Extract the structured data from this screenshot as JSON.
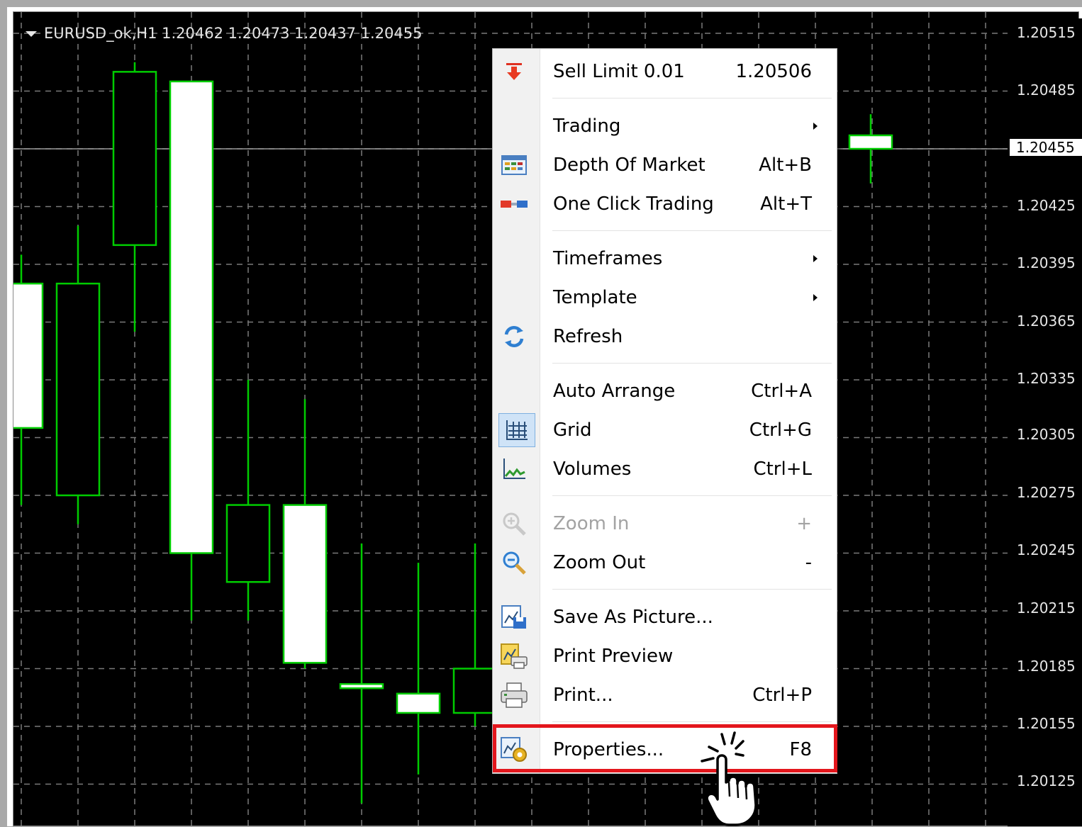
{
  "chart": {
    "symbol_line": "EURUSD_ok,H1 1.20462 1.20473 1.20437 1.20455",
    "bullish_color": "#00cc00",
    "bearish_fill": "#ffffff",
    "grid_color": "#7a7a7a",
    "current_price_line_color": "#9a9a9a"
  },
  "price_scale": {
    "labels": [
      "1.20515",
      "1.20485",
      "1.20455",
      "1.20425",
      "1.20395",
      "1.20365",
      "1.20335",
      "1.20305",
      "1.20275",
      "1.20245",
      "1.20215",
      "1.20185",
      "1.20155",
      "1.20125"
    ],
    "current_price": "1.20455"
  },
  "chart_data": {
    "type": "candlestick",
    "symbol": "EURUSD_ok",
    "timeframe": "H1",
    "ylim": [
      1.20115,
      1.20525
    ],
    "grid": true,
    "candles": [
      {
        "open": 1.20385,
        "high": 1.204,
        "low": 1.2027,
        "close": 1.2031,
        "fill": "white"
      },
      {
        "open": 1.20275,
        "high": 1.20415,
        "low": 1.2026,
        "close": 1.20385,
        "fill": "black"
      },
      {
        "open": 1.20405,
        "high": 1.205,
        "low": 1.2036,
        "close": 1.20495,
        "fill": "black"
      },
      {
        "open": 1.20245,
        "high": 1.2049,
        "low": 1.2021,
        "close": 1.2049,
        "fill": "white"
      },
      {
        "open": 1.2023,
        "high": 1.20335,
        "low": 1.2021,
        "close": 1.2027,
        "fill": "black"
      },
      {
        "open": 1.2027,
        "high": 1.20325,
        "low": 1.20185,
        "close": 1.20188,
        "fill": "white"
      },
      {
        "open": 1.20177,
        "high": 1.2025,
        "low": 1.20115,
        "close": 1.20175,
        "fill": "white"
      },
      {
        "open": 1.20172,
        "high": 1.2024,
        "low": 1.2013,
        "close": 1.20162,
        "fill": "white"
      },
      {
        "open": 1.20162,
        "high": 1.2025,
        "low": 1.20155,
        "close": 1.20185,
        "fill": "black"
      },
      {
        "open": 1.20462,
        "high": 1.20473,
        "low": 1.20437,
        "close": 1.20455,
        "fill": "white"
      }
    ]
  },
  "context_menu": {
    "sell_limit": {
      "label": "Sell Limit 0.01",
      "price": "1.20506"
    },
    "items": [
      {
        "label": "Trading",
        "shortcut": ""
      },
      {
        "label": "Depth Of Market",
        "shortcut": "Alt+B"
      },
      {
        "label": "One Click Trading",
        "shortcut": "Alt+T"
      },
      {
        "label": "Timeframes",
        "shortcut": ""
      },
      {
        "label": "Template",
        "shortcut": ""
      },
      {
        "label": "Refresh",
        "shortcut": ""
      },
      {
        "label": "Auto Arrange",
        "shortcut": "Ctrl+A"
      },
      {
        "label": "Grid",
        "shortcut": "Ctrl+G"
      },
      {
        "label": "Volumes",
        "shortcut": "Ctrl+L"
      },
      {
        "label": "Zoom In",
        "shortcut": "+"
      },
      {
        "label": "Zoom Out",
        "shortcut": "-"
      },
      {
        "label": "Save As Picture...",
        "shortcut": ""
      },
      {
        "label": "Print Preview",
        "shortcut": ""
      },
      {
        "label": "Print...",
        "shortcut": "Ctrl+P"
      },
      {
        "label": "Properties...",
        "shortcut": "F8"
      }
    ],
    "highlight_color": "#e3161c"
  }
}
